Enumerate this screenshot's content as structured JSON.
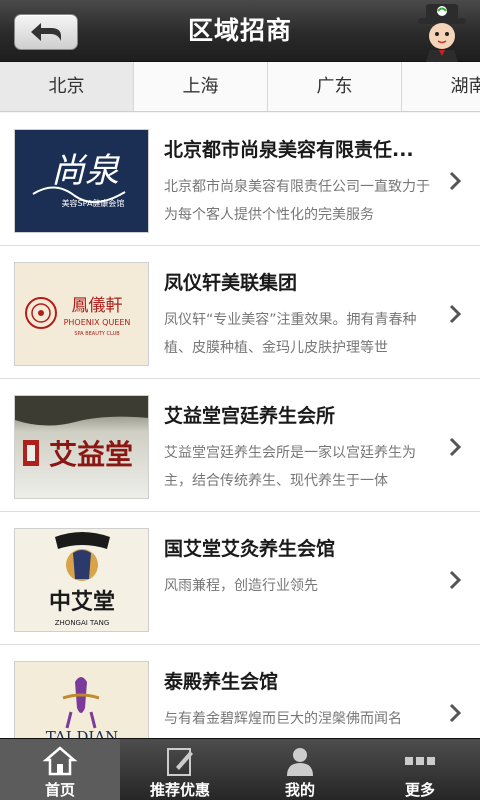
{
  "header": {
    "title": "区域招商"
  },
  "tabs": [
    {
      "label": "北京"
    },
    {
      "label": "上海"
    },
    {
      "label": "广东"
    },
    {
      "label": "湖南"
    }
  ],
  "items": [
    {
      "title": "北京都市尚泉美容有限责任...",
      "desc": "北京都市尚泉美容有限责任公司一直致力于为每个客人提供个性化的完美服务",
      "logo_text": "尚泉",
      "logo_sub": "美容SPA健康会馆"
    },
    {
      "title": "凤仪轩美联集团",
      "desc": "凤仪轩“专业美容”注重效果。拥有青春种植、皮膜种植、金玛儿皮肤护理等世",
      "logo_text": "鳳儀軒",
      "logo_sub": "PHOENIX QUEEN",
      "logo_sub2": "SPA BEAUTY CLUB"
    },
    {
      "title": "艾益堂宫廷养生会所",
      "desc": "艾益堂宫廷养生会所是一家以宫廷养生为主，结合传统养生、现代养生于一体",
      "logo_text": "艾益堂"
    },
    {
      "title": "国艾堂艾灸养生会馆",
      "desc": "风雨兼程，创造行业领先",
      "logo_text": "中艾堂",
      "logo_sub": "ZHONGAI TANG"
    },
    {
      "title": "泰殿养生会馆",
      "desc": "与有着金碧辉煌而巨大的涅槃佛而闻名",
      "logo_text": "TAI DIAN"
    }
  ],
  "nav": [
    {
      "label": "首页",
      "icon": "home-icon"
    },
    {
      "label": "推荐优惠",
      "icon": "edit-icon"
    },
    {
      "label": "我的",
      "icon": "user-icon"
    },
    {
      "label": "更多",
      "icon": "more-icon"
    }
  ],
  "colors": {
    "header_bg": "#2a2a2a",
    "nav_bg": "#262626",
    "active_tab": "#e9e9e9",
    "logo_red": "#b0201a",
    "logo_navy": "#1b2f55"
  }
}
